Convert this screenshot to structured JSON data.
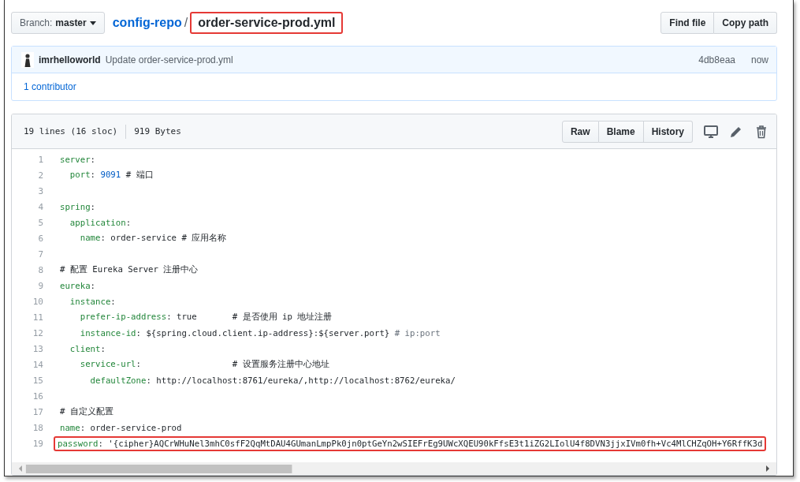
{
  "branch_button": {
    "label": "Branch:",
    "value": "master"
  },
  "breadcrumb": {
    "repo": "config-repo",
    "separator": "/",
    "filename": "order-service-prod.yml",
    "highlighted": true
  },
  "header_buttons": [
    "Find file",
    "Copy path"
  ],
  "commit": {
    "author": "imrhelloworld",
    "message": "Update order-service-prod.yml",
    "sha": "4db8eaa",
    "time": "now"
  },
  "contributors": {
    "count": "1",
    "label": "contributor"
  },
  "file_info": {
    "lines": "19 lines (16 sloc)",
    "size": "919 Bytes"
  },
  "file_buttons": [
    "Raw",
    "Blame",
    "History"
  ],
  "code_lines": [
    {
      "number": "1",
      "tokens": [
        {
          "kind": "key",
          "text": "server"
        },
        {
          "kind": "plain",
          "text": ":"
        }
      ]
    },
    {
      "number": "2",
      "tokens": [
        {
          "kind": "key",
          "text": "  port"
        },
        {
          "kind": "plain",
          "text": ": "
        },
        {
          "kind": "number",
          "text": "9091"
        },
        {
          "kind": "plain",
          "text": " # 端口"
        }
      ]
    },
    {
      "number": "3"
    },
    {
      "number": "4",
      "tokens": [
        {
          "kind": "key",
          "text": "spring"
        },
        {
          "kind": "plain",
          "text": ":"
        }
      ]
    },
    {
      "number": "5",
      "tokens": [
        {
          "kind": "key",
          "text": "  application"
        },
        {
          "kind": "plain",
          "text": ":"
        }
      ]
    },
    {
      "number": "6",
      "tokens": [
        {
          "kind": "key",
          "text": "    name"
        },
        {
          "kind": "plain",
          "text": ": order-service # 应用名称"
        }
      ]
    },
    {
      "number": "7"
    },
    {
      "number": "8",
      "tokens": [
        {
          "kind": "plain",
          "text": "# 配置 Eureka Server 注册中心"
        }
      ]
    },
    {
      "number": "9",
      "tokens": [
        {
          "kind": "key",
          "text": "eureka"
        },
        {
          "kind": "plain",
          "text": ":"
        }
      ]
    },
    {
      "number": "10",
      "tokens": [
        {
          "kind": "key",
          "text": "  instance"
        },
        {
          "kind": "plain",
          "text": ":"
        }
      ]
    },
    {
      "number": "11",
      "tokens": [
        {
          "kind": "key",
          "text": "    prefer-ip-address"
        },
        {
          "kind": "plain",
          "text": ": true       # 是否使用 ip 地址注册"
        }
      ]
    },
    {
      "number": "12",
      "tokens": [
        {
          "kind": "key",
          "text": "    instance-id"
        },
        {
          "kind": "plain",
          "text": ": ${spring.cloud.client.ip-address}:${server.port} "
        },
        {
          "kind": "comment",
          "text": "# ip:port"
        }
      ]
    },
    {
      "number": "13",
      "tokens": [
        {
          "kind": "key",
          "text": "  client"
        },
        {
          "kind": "plain",
          "text": ":"
        }
      ]
    },
    {
      "number": "14",
      "tokens": [
        {
          "kind": "key",
          "text": "    service-url"
        },
        {
          "kind": "plain",
          "text": ":                  # 设置服务注册中心地址"
        }
      ]
    },
    {
      "number": "15",
      "tokens": [
        {
          "kind": "key",
          "text": "      defaultZone"
        },
        {
          "kind": "plain",
          "text": ": http://localhost:8761/eureka/,http://localhost:8762/eureka/"
        }
      ]
    },
    {
      "number": "16"
    },
    {
      "number": "17",
      "tokens": [
        {
          "kind": "plain",
          "text": "# 自定义配置"
        }
      ]
    },
    {
      "number": "18",
      "tokens": [
        {
          "kind": "key",
          "text": "name"
        },
        {
          "kind": "plain",
          "text": ": order-service-prod"
        }
      ]
    },
    {
      "number": "19",
      "highlighted": true,
      "tokens": [
        {
          "kind": "key",
          "text": "password"
        },
        {
          "kind": "plain",
          "text": ": '{cipher}AQCrWHuNel3mhC0sfF2QqMtDAU4GUmanLmpPk0jn0ptGeYn2wSIEFrEg9UWcXQEU90kFfsE3t1iZG2LIolU4f8DVN3jjxIVm0fh+Vc4MlCHZqOH+Y6RffK3d"
        }
      ]
    }
  ]
}
